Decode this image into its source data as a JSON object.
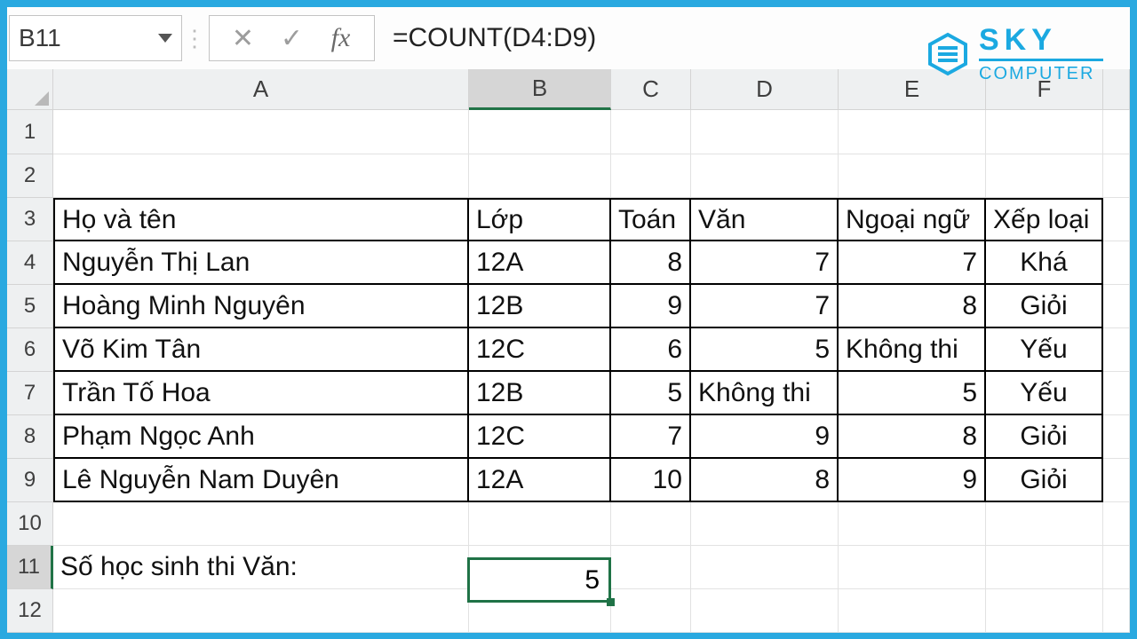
{
  "formula_bar": {
    "cell_ref": "B11",
    "formula": "=COUNT(D4:D9)"
  },
  "logo": {
    "line1": "SKY",
    "line2": "COMPUTER"
  },
  "columns": [
    "A",
    "B",
    "C",
    "D",
    "E",
    "F"
  ],
  "row_numbers": [
    "1",
    "2",
    "3",
    "4",
    "5",
    "6",
    "7",
    "8",
    "9",
    "10",
    "11",
    "12"
  ],
  "headers": {
    "a": "Họ và tên",
    "b": "Lớp",
    "c": "Toán",
    "d": "Văn",
    "e": "Ngoại ngữ",
    "f": "Xếp loại"
  },
  "rows": [
    {
      "name": "Nguyễn Thị Lan",
      "class": "12A",
      "math": "8",
      "lit": "7",
      "lang": "7",
      "grade": "Khá"
    },
    {
      "name": "Hoàng Minh Nguyên",
      "class": "12B",
      "math": "9",
      "lit": "7",
      "lang": "8",
      "grade": "Giỏi"
    },
    {
      "name": "Võ Kim Tân",
      "class": "12C",
      "math": "6",
      "lit": "5",
      "lang": "Không thi",
      "grade": "Yếu"
    },
    {
      "name": "Trần Tố Hoa",
      "class": "12B",
      "math": "5",
      "lit": "Không thi",
      "lang": "5",
      "grade": "Yếu"
    },
    {
      "name": "Phạm Ngọc Anh",
      "class": "12C",
      "math": "7",
      "lit": "9",
      "lang": "8",
      "grade": "Giỏi"
    },
    {
      "name": "Lê Nguyễn Nam Duyên",
      "class": "12A",
      "math": "10",
      "lit": "8",
      "lang": "9",
      "grade": "Giỏi"
    }
  ],
  "summary": {
    "label": "Số học sinh thi Văn:",
    "value": "5"
  }
}
